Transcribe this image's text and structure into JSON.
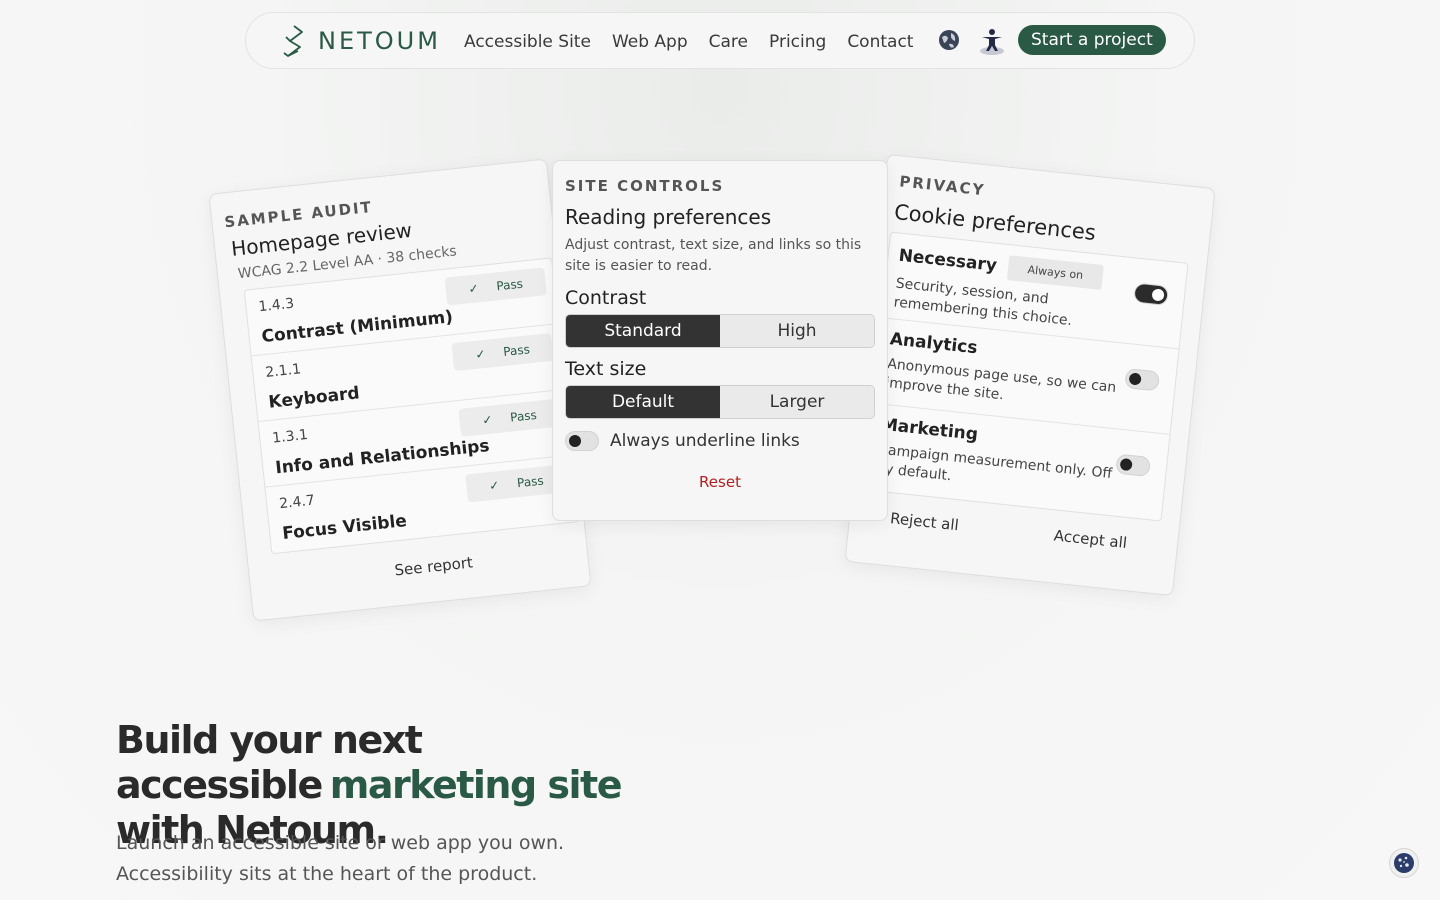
{
  "nav": {
    "logo_text": "NETOUM",
    "links": [
      "Accessible Site",
      "Web App",
      "Care",
      "Pricing",
      "Contact"
    ],
    "cta_label": "Start a project"
  },
  "audit": {
    "eyebrow": "SAMPLE AUDIT",
    "title": "Homepage review",
    "subtitle": "WCAG 2.2 Level AA · 38 checks",
    "items": [
      {
        "code": "1.4.3",
        "name": "Contrast (Minimum)",
        "status": "Pass",
        "check": "✓"
      },
      {
        "code": "2.1.1",
        "name": "Keyboard",
        "status": "Pass",
        "check": "✓"
      },
      {
        "code": "1.3.1",
        "name": "Info and Relationships",
        "status": "Pass",
        "check": "✓"
      },
      {
        "code": "2.4.7",
        "name": "Focus Visible",
        "status": "Pass",
        "check": "✓"
      }
    ],
    "link_label": "See report"
  },
  "controls": {
    "eyebrow": "SITE CONTROLS",
    "title": "Reading preferences",
    "description": "Adjust contrast, text size, and links so this site is easier to read.",
    "contrast_label": "Contrast",
    "contrast_options": [
      "Standard",
      "High"
    ],
    "contrast_selected": "Standard",
    "text_size_label": "Text size",
    "text_size_options": [
      "Default",
      "Larger"
    ],
    "text_size_selected": "Default",
    "underline_label": "Always underline links",
    "underline_on": false,
    "reset_label": "Reset"
  },
  "privacy": {
    "eyebrow": "PRIVACY",
    "title": "Cookie preferences",
    "items": [
      {
        "name": "Necessary",
        "badge": "Always on",
        "description": "Security, session, and remembering this choice.",
        "on": true
      },
      {
        "name": "Analytics",
        "badge": "",
        "description": "Anonymous page use, so we can improve the site.",
        "on": false
      },
      {
        "name": "Marketing",
        "badge": "",
        "description": "Campaign measurement only. Off by default.",
        "on": false
      }
    ],
    "reject_label": "Reject all",
    "accept_label": "Accept all"
  },
  "hero": {
    "title_start": "Build your next accessible",
    "title_accent": "marketing site",
    "title_end": "with Netoum.",
    "subtitle": "Launch an accessible site or web app you own. Accessibility sits at the heart of the product."
  },
  "colors": {
    "brand": "#2a5a45",
    "reset": "#b02020"
  },
  "icons": {
    "globe": "globe-icon",
    "accessibility": "accessibility-icon",
    "cookie": "cookie-icon"
  }
}
